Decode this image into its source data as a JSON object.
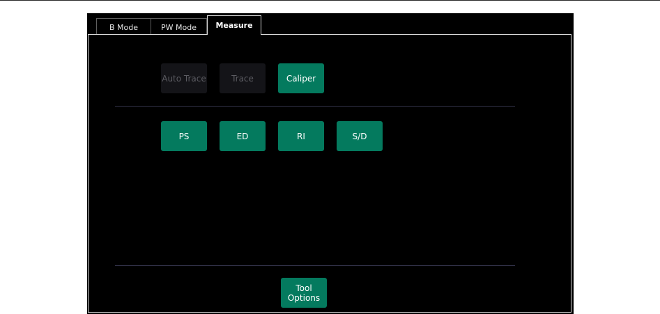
{
  "tabs": [
    {
      "label": "B Mode",
      "active": false
    },
    {
      "label": "PW Mode",
      "active": false
    },
    {
      "label": "Measure",
      "active": true
    }
  ],
  "trace_buttons": {
    "auto_trace": {
      "label": "Auto Trace",
      "enabled": false
    },
    "trace": {
      "label": "Trace",
      "enabled": false
    },
    "caliper": {
      "label": "Caliper",
      "enabled": true
    }
  },
  "measure_buttons": {
    "ps": {
      "label": "PS"
    },
    "ed": {
      "label": "ED"
    },
    "ri": {
      "label": "RI"
    },
    "sd": {
      "label": "S/D"
    }
  },
  "footer": {
    "tool_options_line1": "Tool",
    "tool_options_line2": "Options"
  },
  "colors": {
    "accent": "#047a5e",
    "disabled_bg": "#141418",
    "disabled_text": "#5c5c62",
    "background": "#000000"
  }
}
